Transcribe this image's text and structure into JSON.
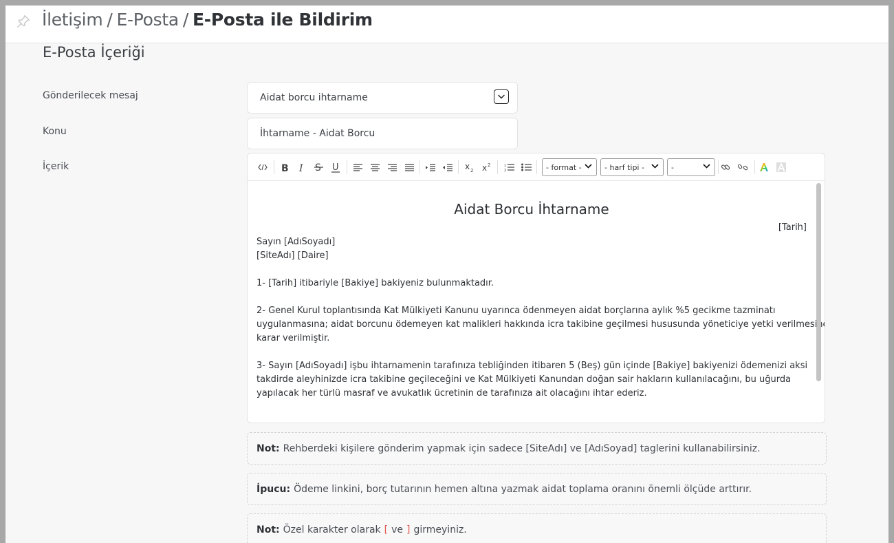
{
  "breadcrumb": {
    "item1": "İletişim",
    "item2": "E-Posta",
    "current": "E-Posta ile Bildirim",
    "separator": "/"
  },
  "section_title": "E-Posta İçeriği",
  "form": {
    "message_label": "Gönderilecek mesaj",
    "message_value": "Aidat borcu ihtarname",
    "subject_label": "Konu",
    "subject_value": "İhtarname - Aidat Borcu",
    "content_label": "İçerik"
  },
  "toolbar": {
    "format_select": "- format -",
    "font_select": "- harf tipi -",
    "size_select": "-",
    "icons": [
      "source-code",
      "bold",
      "italic",
      "strikethrough",
      "underline",
      "align-left",
      "align-center",
      "align-right",
      "justify",
      "outdent",
      "indent",
      "subscript",
      "superscript",
      "ordered-list",
      "unordered-list",
      "link",
      "unlink",
      "font-color",
      "background-color"
    ]
  },
  "document": {
    "title": "Aidat Borcu İhtarname",
    "date": "[Tarih]",
    "lines": [
      "Sayın [AdıSoyadı]",
      "[SiteAdı] [Daire]",
      "1- [Tarih] itibariyle [Bakiye] bakiyeniz bulunmaktadır.",
      "2- Genel Kurul toplantısında Kat Mülkiyeti Kanunu uyarınca ödenmeyen aidat borçlarına aylık %5 gecikme tazminatı",
      "uygulanmasına; aidat borcunu ödemeyen kat malikleri hakkında icra takibine geçilmesi hususunda yöneticiye yetki verilmesine",
      "karar verilmiştir.",
      "3- Sayın [AdıSoyadı] işbu ihtarnamenin tarafınıza tebliğinden itibaren 5 (Beş) gün içinde [Bakiye] bakiyenizi ödemenizi aksi",
      "takdirde aleyhinizde icra takibine geçileceğini ve Kat Mülkiyeti Kanundan doğan sair hakların kullanılacağını, bu uğurda",
      "yapılacak her türlü masraf ve avukatlık ücretinin de tarafınıza ait olacağını ihtar ederiz."
    ]
  },
  "notes": {
    "note1_label": "Not:",
    "note1_text": "Rehberdeki kişilere gönderim yapmak için sadece [SiteAdı] ve [AdıSoyad] taglerini kullanabilirsiniz.",
    "tip_label": "İpucu:",
    "tip_text": "Ödeme linkini, borç tutarının hemen altına yazmak aidat toplama oranını önemli ölçüde arttırır.",
    "note2_label": "Not:",
    "note2_prefix": "Özel karakter olarak",
    "note2_open": "[",
    "note2_and": "ve",
    "note2_close": "]",
    "note2_suffix": "girmeyiniz."
  },
  "colors": {
    "bracket_accent": "#e0584e"
  }
}
